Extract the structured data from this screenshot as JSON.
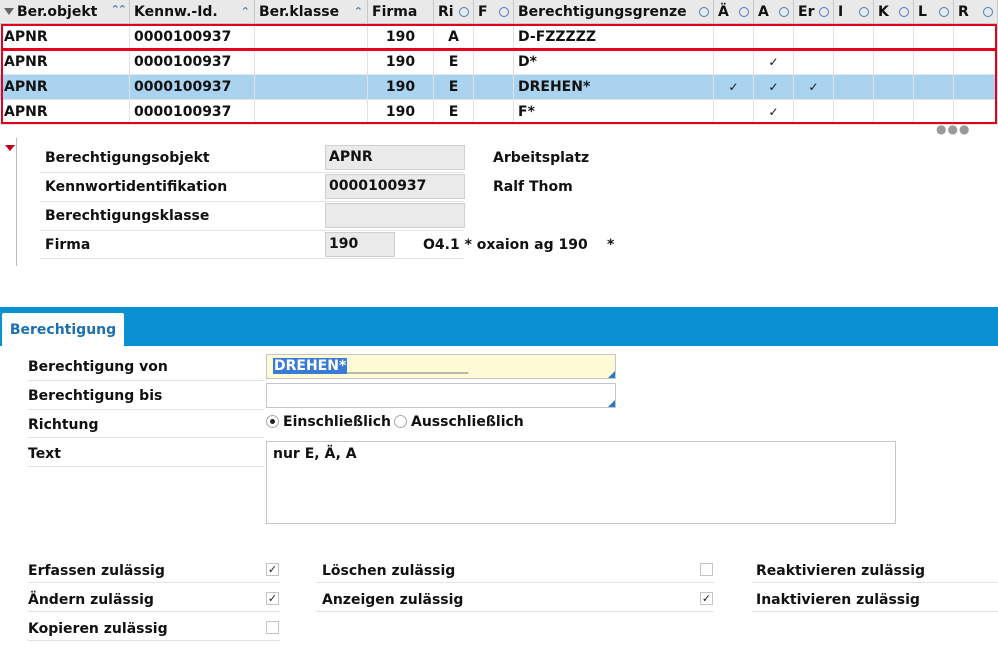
{
  "grid": {
    "headers": [
      {
        "label": "Ber.objekt",
        "marker": "sort-double"
      },
      {
        "label": "Kennw.-Id.",
        "marker": "sort-up"
      },
      {
        "label": "Ber.klasse",
        "marker": "sort-up"
      },
      {
        "label": "Firma",
        "marker": ""
      },
      {
        "label": "Ri",
        "marker": "circle"
      },
      {
        "label": "F",
        "marker": "circle"
      },
      {
        "label": "Berechtigungsgrenze",
        "marker": "circle"
      },
      {
        "label": "Ä",
        "marker": "circle"
      },
      {
        "label": "A",
        "marker": "circle"
      },
      {
        "label": "Er",
        "marker": "circle"
      },
      {
        "label": "I",
        "marker": "circle"
      },
      {
        "label": "K",
        "marker": "circle"
      },
      {
        "label": "L",
        "marker": "circle"
      },
      {
        "label": "R",
        "marker": "circle"
      }
    ],
    "rows": [
      {
        "objekt": "APNR",
        "kennw": "0000100937",
        "klasse": "",
        "firma": "190",
        "ri": "A",
        "f": "",
        "grenze": "D-FZZZZZ",
        "ae": "",
        "a": "",
        "er": "",
        "i": "",
        "k": "",
        "l": "",
        "r": "",
        "selected": false
      },
      {
        "objekt": "APNR",
        "kennw": "0000100937",
        "klasse": "",
        "firma": "190",
        "ri": "E",
        "f": "",
        "grenze": "D*",
        "ae": "",
        "a": "✓",
        "er": "",
        "i": "",
        "k": "",
        "l": "",
        "r": "",
        "selected": false
      },
      {
        "objekt": "APNR",
        "kennw": "0000100937",
        "klasse": "",
        "firma": "190",
        "ri": "E",
        "f": "",
        "grenze": "DREHEN*",
        "ae": "✓",
        "a": "✓",
        "er": "✓",
        "i": "",
        "k": "",
        "l": "",
        "r": "",
        "selected": true
      },
      {
        "objekt": "APNR",
        "kennw": "0000100937",
        "klasse": "",
        "firma": "190",
        "ri": "E",
        "f": "",
        "grenze": "F*",
        "ae": "",
        "a": "✓",
        "er": "",
        "i": "",
        "k": "",
        "l": "",
        "r": "",
        "selected": false
      }
    ]
  },
  "detail": {
    "objekt_label": "Berechtigungsobjekt",
    "objekt_value": "APNR",
    "objekt_desc": "Arbeitsplatz",
    "kennw_label": "Kennwortidentifikation",
    "kennw_value": "0000100937",
    "kennw_desc": "Ralf Thom",
    "klasse_label": "Berechtigungsklasse",
    "klasse_value": "",
    "firma_label": "Firma",
    "firma_value": "190",
    "firma_desc": "O4.1 * oxaion ag 190",
    "firma_star": "*"
  },
  "tab": {
    "label": "Berechtigung"
  },
  "form": {
    "von_label": "Berechtigung von",
    "von_value": "DREHEN*",
    "von_fill": "____________________",
    "bis_label": "Berechtigung bis",
    "bis_value": "",
    "richtung_label": "Richtung",
    "richtung_opt1": "Einschließlich",
    "richtung_opt2": "Ausschließlich",
    "text_label": "Text",
    "text_value": "nur E, Ä, A"
  },
  "permissions": {
    "erfassen": {
      "label": "Erfassen zulässig",
      "checked": true
    },
    "aendern": {
      "label": "Ändern zulässig",
      "checked": true
    },
    "kopieren": {
      "label": "Kopieren zulässig",
      "checked": false
    },
    "loeschen": {
      "label": "Löschen zulässig",
      "checked": false
    },
    "anzeigen": {
      "label": "Anzeigen zulässig",
      "checked": true
    },
    "reaktivieren": {
      "label": "Reaktivieren zulässig"
    },
    "inaktivieren": {
      "label": "Inaktivieren zulässig"
    }
  },
  "colors": {
    "accent": "#0a8fd2",
    "selection": "#a9d3ef",
    "highlight_frame": "#e2001a"
  }
}
